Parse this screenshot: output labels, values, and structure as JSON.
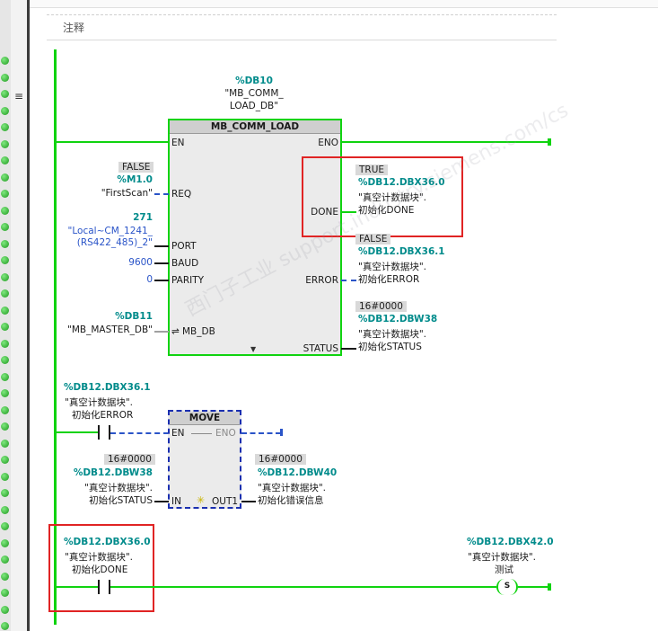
{
  "network": {
    "comment_label": "注释"
  },
  "fb_comm_load": {
    "instance_db": "%DB10",
    "instance_name_line1": "\"MB_COMM_",
    "instance_name_line2": "LOAD_DB\"",
    "title": "MB_COMM_LOAD",
    "pins": {
      "en": "EN",
      "eno": "ENO",
      "req": "REQ",
      "done": "DONE",
      "port": "PORT",
      "baud": "BAUD",
      "parity": "PARITY",
      "error": "ERROR",
      "mb_db": "MB_DB",
      "status": "STATUS"
    },
    "req": {
      "value": "FALSE",
      "address": "%M1.0",
      "symbol": "\"FirstScan\""
    },
    "port": {
      "value": "271",
      "symbol_line1": "\"Local~CM_1241_",
      "symbol_line2": "(RS422_485)_2\""
    },
    "baud": {
      "value": "9600"
    },
    "parity": {
      "value": "0"
    },
    "mb_db": {
      "address": "%DB11",
      "symbol": "\"MB_MASTER_DB\""
    },
    "done": {
      "value": "TRUE",
      "address": "%DB12.DBX36.0",
      "symbol_line1": "\"真空计数据块\".",
      "symbol_line2": "初始化DONE"
    },
    "error": {
      "value": "FALSE",
      "address": "%DB12.DBX36.1",
      "symbol_line1": "\"真空计数据块\".",
      "symbol_line2": "初始化ERROR"
    },
    "status": {
      "value": "16#0000",
      "address": "%DB12.DBW38",
      "symbol_line1": "\"真空计数据块\".",
      "symbol_line2": "初始化STATUS"
    }
  },
  "contact_error": {
    "address": "%DB12.DBX36.1",
    "symbol_line1": "\"真空计数据块\".",
    "symbol_line2": "初始化ERROR"
  },
  "move_box": {
    "title": "MOVE",
    "pins": {
      "en": "EN",
      "eno": "ENO",
      "in": "IN",
      "out1": "OUT1"
    },
    "in": {
      "value": "16#0000",
      "address": "%DB12.DBW38",
      "symbol_line1": "\"真空计数据块\".",
      "symbol_line2": "初始化STATUS"
    },
    "out": {
      "value": "16#0000",
      "address": "%DB12.DBW40",
      "symbol_line1": "\"真空计数据块\".",
      "symbol_line2": "初始化错误信息"
    }
  },
  "contact_done": {
    "address": "%DB12.DBX36.0",
    "symbol_line1": "\"真空计数据块\".",
    "symbol_line2": "初始化DONE"
  },
  "coil_set": {
    "address": "%DB12.DBX42.0",
    "symbol_line1": "\"真空计数据块\".",
    "symbol_line2": "测试",
    "letter": "S"
  },
  "gutter_icon": "≡",
  "watermark": "西门子工业 support.industry.siemens.com/cs"
}
